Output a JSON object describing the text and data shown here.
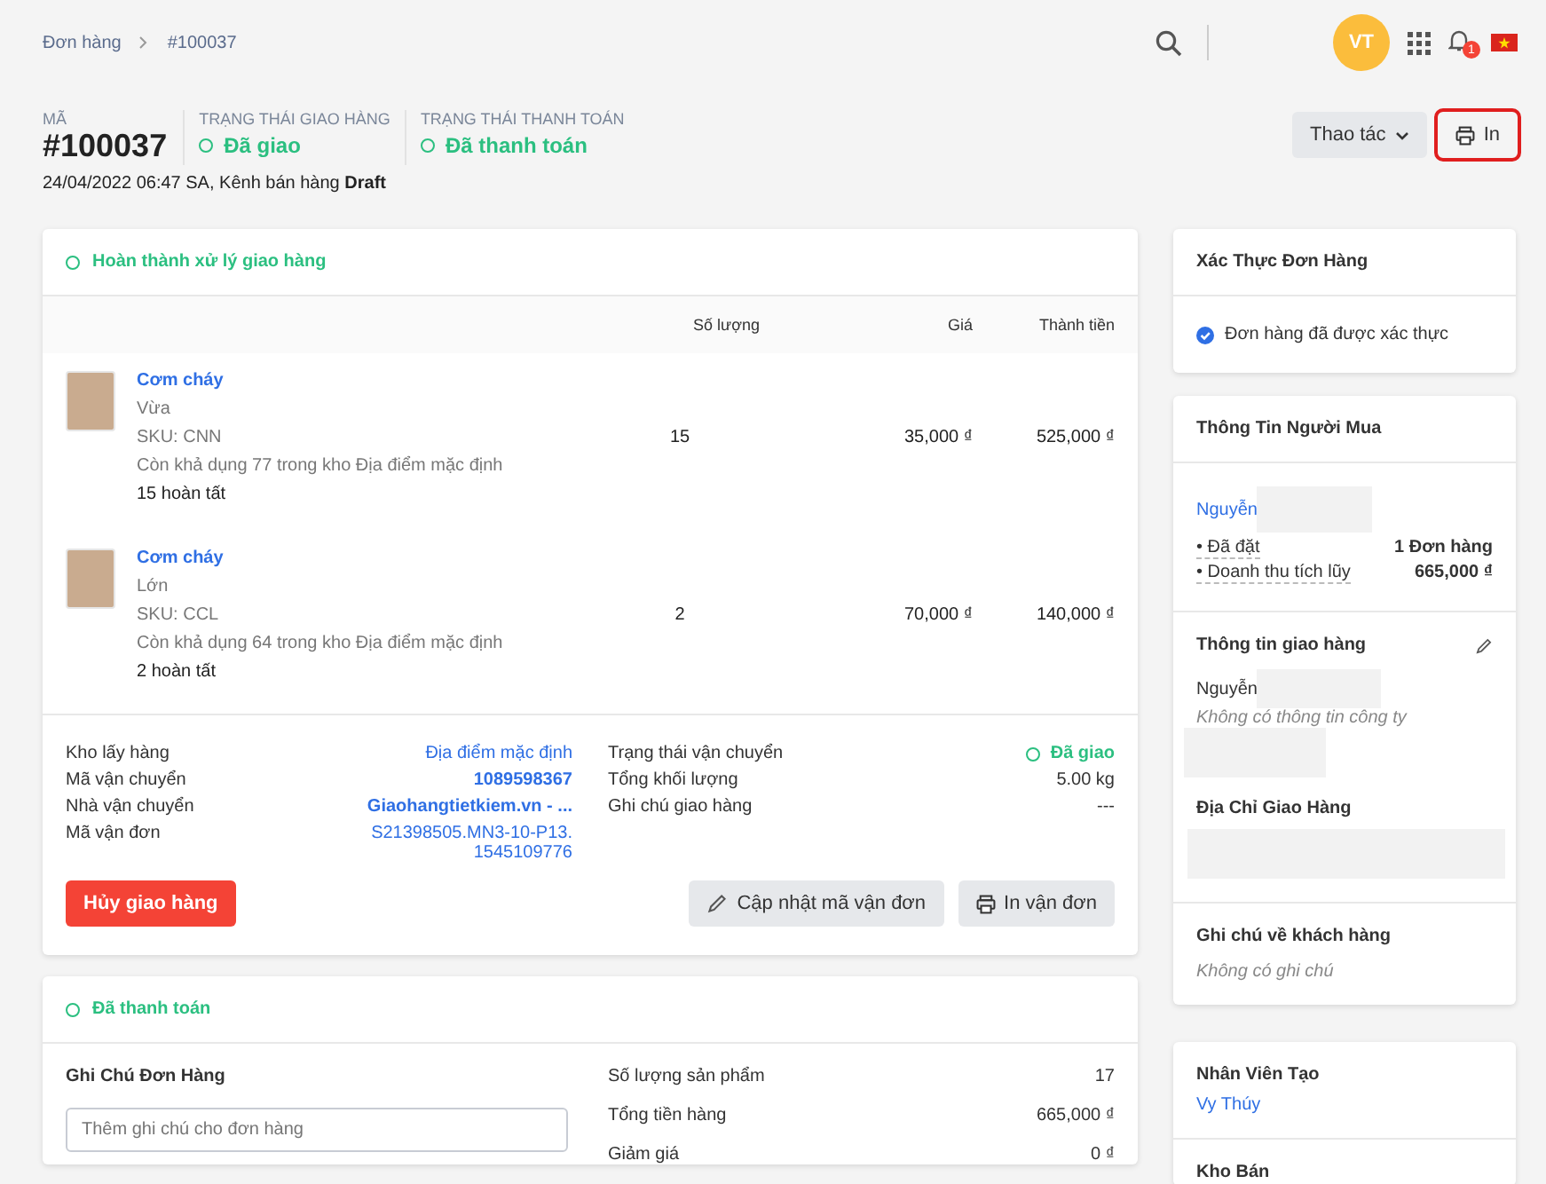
{
  "breadcrumb": [
    "Đơn hàng",
    "#100037"
  ],
  "topbar": {
    "avatar": "VT",
    "notifications": "1"
  },
  "order": {
    "code_label": "MÃ",
    "code": "#100037",
    "statuses": [
      {
        "label": "TRẠNG THÁI GIAO HÀNG",
        "value": "Đã giao"
      },
      {
        "label": "TRẠNG THÁI THANH TOÁN",
        "value": "Đã thanh toán"
      }
    ],
    "meta": "24/04/2022 06:47 SA, Kênh bán hàng **Draft**",
    "actions": [
      {
        "kind": "dropdown",
        "label": "Thao tác",
        "highlighted": false
      },
      {
        "kind": "print",
        "label": "In",
        "highlighted": true
      }
    ]
  },
  "fulfillment": {
    "title": "Hoàn thành xử lý giao hàng",
    "columns": [
      "Số lượng",
      "Giá",
      "Thành tiền"
    ],
    "items": [
      {
        "name": "Cơm cháy",
        "variant": "Vừa",
        "sku": "SKU: CNN",
        "stock": "Còn khả dụng 77 trong kho Địa điểm mặc định",
        "fulfilled": "15 hoàn tất",
        "quantity": "15",
        "price": "35,000 ₫",
        "total": "525,000 ₫"
      },
      {
        "name": "Cơm cháy",
        "variant": "Lớn",
        "sku": "SKU: CCL",
        "stock": "Còn khả dụng 64 trong kho Địa điểm mặc định",
        "fulfilled": "2 hoàn tất",
        "quantity": "2",
        "price": "70,000 ₫",
        "total": "140,000 ₫"
      }
    ],
    "details_left": [
      {
        "label": "Kho lấy hàng",
        "value": "Địa điểm mặc định",
        "kind": "link"
      },
      {
        "label": "Mã vận chuyển",
        "value": "1089598367",
        "kind": "strong-link"
      },
      {
        "label": "Nhà vận chuyển",
        "value": "Giaohangtietkiem.vn - ...",
        "kind": "strong-link"
      },
      {
        "label": "Mã vận đơn",
        "value": "S21398505.MN3-10-P13.\n1545109776",
        "kind": "link"
      }
    ],
    "details_right": [
      {
        "label": "Trạng thái vận chuyển",
        "value": "Đã giao",
        "kind": "status"
      },
      {
        "label": "Tổng khối lượng",
        "value": "5.00 kg",
        "kind": "plain"
      },
      {
        "label": "Ghi chú giao hàng",
        "value": "---",
        "kind": "plain"
      }
    ],
    "buttons": [
      {
        "kind": "danger",
        "label": "Hủy giao hàng"
      },
      {
        "kind": "edit",
        "label": "Cập nhật mã vận đơn"
      },
      {
        "kind": "print",
        "label": "In vận đơn"
      }
    ]
  },
  "payment": {
    "title": "Đã thanh toán",
    "note_label": "Ghi Chú Đơn Hàng",
    "note_placeholder": "Thêm ghi chú cho đơn hàng",
    "summary": [
      {
        "label": "Số lượng sản phẩm",
        "value": "17"
      },
      {
        "label": "Tổng tiền hàng",
        "value": "665,000 ₫"
      },
      {
        "label": "Giảm giá",
        "value": "0 ₫"
      }
    ]
  },
  "verification": {
    "title": "Xác Thực Đơn Hàng",
    "status": "Đơn hàng đã được xác thực",
    "verified": true
  },
  "buyer": {
    "title": "Thông Tin Người Mua",
    "name": "Nguyễn",
    "stats": [
      {
        "label": "• Đã đặt",
        "value": "1 Đơn hàng"
      },
      {
        "label": "• Doanh thu tích lũy",
        "value": "665,000 ₫"
      }
    ],
    "shipping_title": "Thông tin giao hàng",
    "shipping_name": "Nguyễn",
    "company": "Không có thông tin công ty",
    "address_title": "Địa Chỉ Giao Hàng",
    "note_title": "Ghi chú về khách hàng",
    "note": "Không có ghi chú"
  },
  "staff": {
    "creator_label": "Nhân Viên Tạo",
    "creator": "Vy Thúy",
    "warehouse_label": "Kho Bán"
  }
}
